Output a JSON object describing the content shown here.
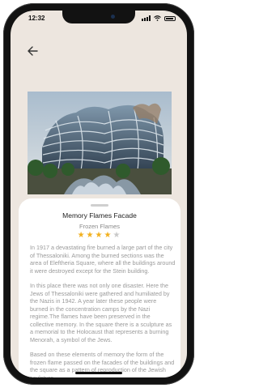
{
  "status_bar": {
    "time": "12:32"
  },
  "header": {
    "back_icon": "arrow-left-icon"
  },
  "place": {
    "title": "Memory Flames Facade",
    "subtitle": "Frozen Flames",
    "rating": 4,
    "rating_max": 5,
    "paragraphs": [
      "In 1917 a devastating fire burned a large part of the city of Thessaloniki. Among the burned sections was the area of Eleftheria Square, where all the buildings around it were destroyed except for the Stein building.",
      "In this place there was not only one disaster. Here the Jews of Thessaloniki were gathered and humiliated by the Nazis in 1942. A year later these people were burned in the concentration camps by the Nazi regime.The flames have been preserved in the collective memory. In the square there is a sculpture as a memorial to the Holocaust that represents a burning Menorah, a symbol of the Jews.",
      "Based on these elements of memory the form of the frozen flame passed on the facades of the buildings and the square as a pattern of reproduction of the Jewish sculpture."
    ]
  },
  "colors": {
    "star": "#f2b01e",
    "star_empty": "#c9c9c9",
    "screen_bg": "#ede6df"
  }
}
